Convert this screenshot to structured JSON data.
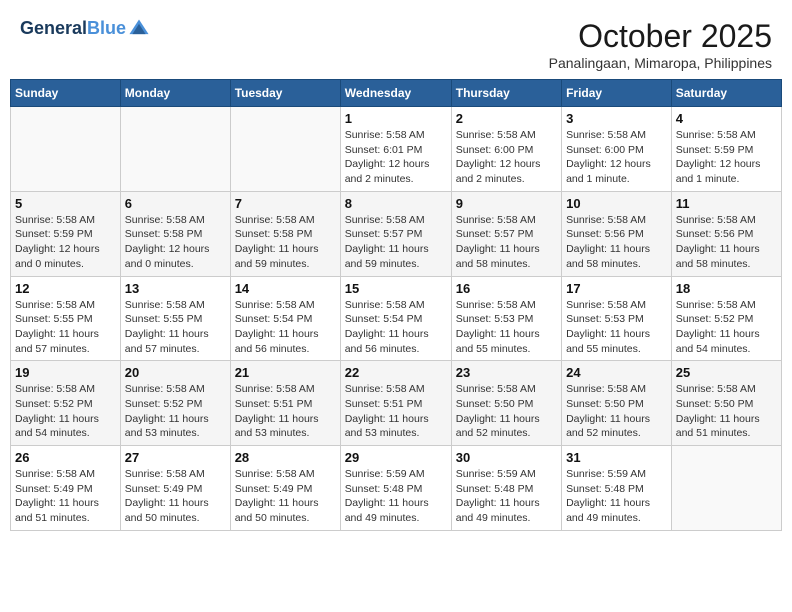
{
  "header": {
    "logo_line1": "General",
    "logo_line2": "Blue",
    "month": "October 2025",
    "location": "Panalingaan, Mimaropa, Philippines"
  },
  "weekdays": [
    "Sunday",
    "Monday",
    "Tuesday",
    "Wednesday",
    "Thursday",
    "Friday",
    "Saturday"
  ],
  "weeks": [
    [
      {
        "day": "",
        "info": ""
      },
      {
        "day": "",
        "info": ""
      },
      {
        "day": "",
        "info": ""
      },
      {
        "day": "1",
        "info": "Sunrise: 5:58 AM\nSunset: 6:01 PM\nDaylight: 12 hours\nand 2 minutes."
      },
      {
        "day": "2",
        "info": "Sunrise: 5:58 AM\nSunset: 6:00 PM\nDaylight: 12 hours\nand 2 minutes."
      },
      {
        "day": "3",
        "info": "Sunrise: 5:58 AM\nSunset: 6:00 PM\nDaylight: 12 hours\nand 1 minute."
      },
      {
        "day": "4",
        "info": "Sunrise: 5:58 AM\nSunset: 5:59 PM\nDaylight: 12 hours\nand 1 minute."
      }
    ],
    [
      {
        "day": "5",
        "info": "Sunrise: 5:58 AM\nSunset: 5:59 PM\nDaylight: 12 hours\nand 0 minutes."
      },
      {
        "day": "6",
        "info": "Sunrise: 5:58 AM\nSunset: 5:58 PM\nDaylight: 12 hours\nand 0 minutes."
      },
      {
        "day": "7",
        "info": "Sunrise: 5:58 AM\nSunset: 5:58 PM\nDaylight: 11 hours\nand 59 minutes."
      },
      {
        "day": "8",
        "info": "Sunrise: 5:58 AM\nSunset: 5:57 PM\nDaylight: 11 hours\nand 59 minutes."
      },
      {
        "day": "9",
        "info": "Sunrise: 5:58 AM\nSunset: 5:57 PM\nDaylight: 11 hours\nand 58 minutes."
      },
      {
        "day": "10",
        "info": "Sunrise: 5:58 AM\nSunset: 5:56 PM\nDaylight: 11 hours\nand 58 minutes."
      },
      {
        "day": "11",
        "info": "Sunrise: 5:58 AM\nSunset: 5:56 PM\nDaylight: 11 hours\nand 58 minutes."
      }
    ],
    [
      {
        "day": "12",
        "info": "Sunrise: 5:58 AM\nSunset: 5:55 PM\nDaylight: 11 hours\nand 57 minutes."
      },
      {
        "day": "13",
        "info": "Sunrise: 5:58 AM\nSunset: 5:55 PM\nDaylight: 11 hours\nand 57 minutes."
      },
      {
        "day": "14",
        "info": "Sunrise: 5:58 AM\nSunset: 5:54 PM\nDaylight: 11 hours\nand 56 minutes."
      },
      {
        "day": "15",
        "info": "Sunrise: 5:58 AM\nSunset: 5:54 PM\nDaylight: 11 hours\nand 56 minutes."
      },
      {
        "day": "16",
        "info": "Sunrise: 5:58 AM\nSunset: 5:53 PM\nDaylight: 11 hours\nand 55 minutes."
      },
      {
        "day": "17",
        "info": "Sunrise: 5:58 AM\nSunset: 5:53 PM\nDaylight: 11 hours\nand 55 minutes."
      },
      {
        "day": "18",
        "info": "Sunrise: 5:58 AM\nSunset: 5:52 PM\nDaylight: 11 hours\nand 54 minutes."
      }
    ],
    [
      {
        "day": "19",
        "info": "Sunrise: 5:58 AM\nSunset: 5:52 PM\nDaylight: 11 hours\nand 54 minutes."
      },
      {
        "day": "20",
        "info": "Sunrise: 5:58 AM\nSunset: 5:52 PM\nDaylight: 11 hours\nand 53 minutes."
      },
      {
        "day": "21",
        "info": "Sunrise: 5:58 AM\nSunset: 5:51 PM\nDaylight: 11 hours\nand 53 minutes."
      },
      {
        "day": "22",
        "info": "Sunrise: 5:58 AM\nSunset: 5:51 PM\nDaylight: 11 hours\nand 53 minutes."
      },
      {
        "day": "23",
        "info": "Sunrise: 5:58 AM\nSunset: 5:50 PM\nDaylight: 11 hours\nand 52 minutes."
      },
      {
        "day": "24",
        "info": "Sunrise: 5:58 AM\nSunset: 5:50 PM\nDaylight: 11 hours\nand 52 minutes."
      },
      {
        "day": "25",
        "info": "Sunrise: 5:58 AM\nSunset: 5:50 PM\nDaylight: 11 hours\nand 51 minutes."
      }
    ],
    [
      {
        "day": "26",
        "info": "Sunrise: 5:58 AM\nSunset: 5:49 PM\nDaylight: 11 hours\nand 51 minutes."
      },
      {
        "day": "27",
        "info": "Sunrise: 5:58 AM\nSunset: 5:49 PM\nDaylight: 11 hours\nand 50 minutes."
      },
      {
        "day": "28",
        "info": "Sunrise: 5:58 AM\nSunset: 5:49 PM\nDaylight: 11 hours\nand 50 minutes."
      },
      {
        "day": "29",
        "info": "Sunrise: 5:59 AM\nSunset: 5:48 PM\nDaylight: 11 hours\nand 49 minutes."
      },
      {
        "day": "30",
        "info": "Sunrise: 5:59 AM\nSunset: 5:48 PM\nDaylight: 11 hours\nand 49 minutes."
      },
      {
        "day": "31",
        "info": "Sunrise: 5:59 AM\nSunset: 5:48 PM\nDaylight: 11 hours\nand 49 minutes."
      },
      {
        "day": "",
        "info": ""
      }
    ]
  ]
}
